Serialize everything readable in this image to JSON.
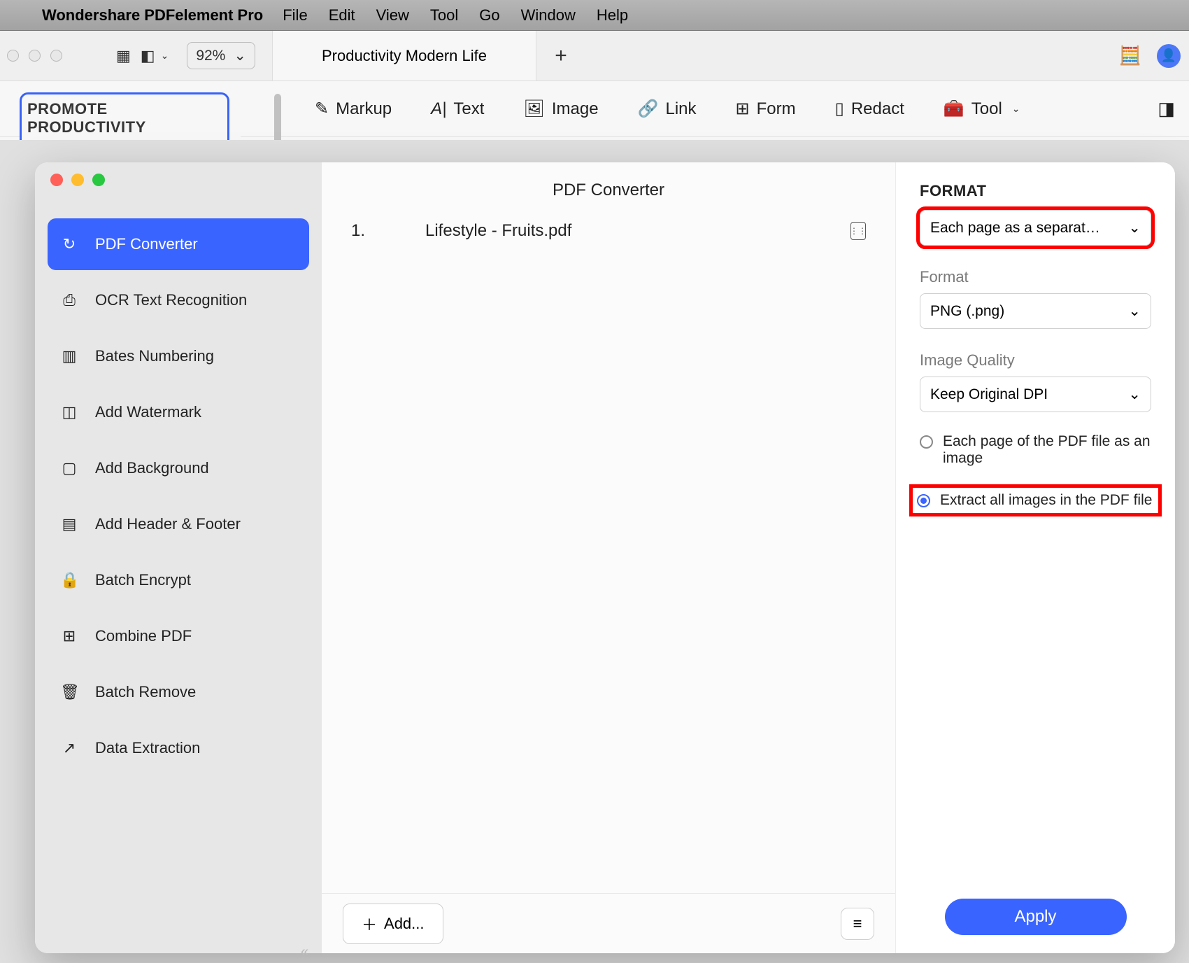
{
  "menubar": {
    "app_name": "Wondershare PDFelement Pro",
    "items": [
      "File",
      "Edit",
      "View",
      "Tool",
      "Go",
      "Window",
      "Help"
    ]
  },
  "top": {
    "zoom": "92%",
    "tab_label": "Productivity Modern Life"
  },
  "toolbar": {
    "markup": "Markup",
    "text": "Text",
    "image": "Image",
    "link": "Link",
    "form": "Form",
    "redact": "Redact",
    "tool": "Tool"
  },
  "thumb": {
    "title": "PROMOTE PRODUCTIVITY"
  },
  "modal": {
    "title": "PDF Converter",
    "side_items": [
      {
        "icon": "↻",
        "label": "PDF Converter",
        "active": true
      },
      {
        "icon": "⎙",
        "label": "OCR Text Recognition"
      },
      {
        "icon": "▥",
        "label": "Bates Numbering"
      },
      {
        "icon": "◫",
        "label": "Add Watermark"
      },
      {
        "icon": "▢",
        "label": "Add Background"
      },
      {
        "icon": "▤",
        "label": "Add Header & Footer"
      },
      {
        "icon": "🔒",
        "label": "Batch Encrypt"
      },
      {
        "icon": "⊞",
        "label": "Combine PDF"
      },
      {
        "icon": "🗑",
        "label": "Batch Remove"
      },
      {
        "icon": "↗",
        "label": "Data Extraction"
      }
    ],
    "file": {
      "index": "1.",
      "name": "Lifestyle - Fruits.pdf"
    },
    "add_label": "Add..."
  },
  "right": {
    "heading": "FORMAT",
    "mode_value": "Each page as a separat…",
    "format_label": "Format",
    "format_value": "PNG (.png)",
    "quality_label": "Image Quality",
    "quality_value": "Keep Original DPI",
    "radio1": "Each page of the PDF file as an image",
    "radio2": "Extract all images in the PDF file",
    "apply": "Apply"
  }
}
